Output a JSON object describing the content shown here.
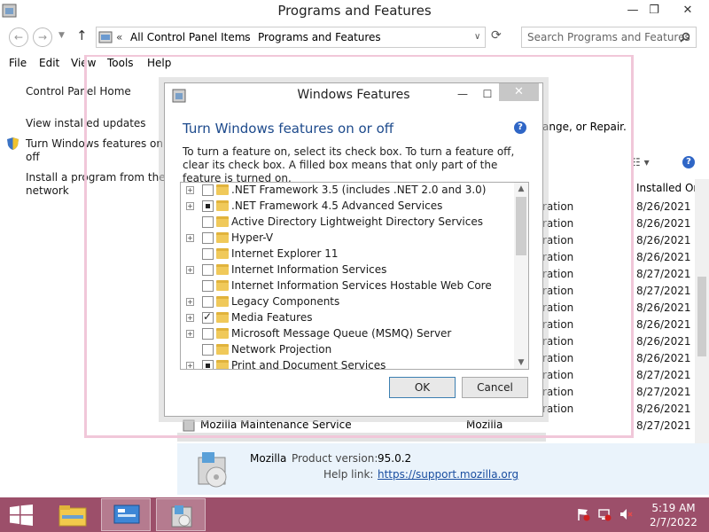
{
  "window": {
    "title": "Programs and Features",
    "controls": {
      "minimize": "—",
      "maximize": "❐",
      "close": "✕"
    }
  },
  "address": {
    "prefix": "«",
    "crumbs": [
      "All Control Panel Items",
      "Programs and Features"
    ],
    "separator": "›",
    "search_placeholder": "Search Programs and Features"
  },
  "menu": [
    "File",
    "Edit",
    "View",
    "Tools",
    "Help"
  ],
  "left_pane": {
    "home": "Control Panel Home",
    "view_updates": "View installed updates",
    "turn_features_line1": "Turn Windows features on or",
    "turn_features_line2": "off",
    "install_line1": "Install a program from the",
    "install_line2": "network"
  },
  "background": {
    "right_text": "ange, or Repair.",
    "installed_on_header": "Installed On",
    "publisher_fragments": [
      "ration",
      "ration",
      "ration",
      "ration",
      "ration",
      "ration",
      "ration",
      "ration",
      "ration",
      "ration",
      "ration",
      "ration",
      "ration"
    ],
    "installed_dates": [
      "8/26/2021",
      "8/26/2021",
      "8/26/2021",
      "8/26/2021",
      "8/27/2021",
      "8/27/2021",
      "8/26/2021",
      "8/26/2021",
      "8/26/2021",
      "8/26/2021",
      "8/27/2021",
      "8/27/2021",
      "8/26/2021",
      "8/27/2021"
    ],
    "bottom_row": {
      "name": "Mozilla Maintenance Service",
      "publisher": "Mozilla"
    }
  },
  "details": {
    "name": "Mozilla",
    "product_version_label": "Product version:",
    "product_version": "95.0.2",
    "help_link_label": "Help link:",
    "help_link": "https://support.mozilla.org"
  },
  "dialog": {
    "title": "Windows Features",
    "heading": "Turn Windows features on or off",
    "help_glyph": "?",
    "instructions": "To turn a feature on, select its check box. To turn a feature off, clear its check box. A filled box means that only part of the feature is turned on.",
    "features": [
      {
        "name": ".NET Framework 3.5 (includes .NET 2.0 and 3.0)",
        "expandable": true,
        "state": "unchecked"
      },
      {
        "name": ".NET Framework 4.5 Advanced Services",
        "expandable": true,
        "state": "partial"
      },
      {
        "name": "Active Directory Lightweight Directory Services",
        "expandable": false,
        "state": "unchecked"
      },
      {
        "name": "Hyper-V",
        "expandable": true,
        "state": "unchecked"
      },
      {
        "name": "Internet Explorer 11",
        "expandable": false,
        "state": "unchecked"
      },
      {
        "name": "Internet Information Services",
        "expandable": true,
        "state": "unchecked"
      },
      {
        "name": "Internet Information Services Hostable Web Core",
        "expandable": false,
        "state": "unchecked"
      },
      {
        "name": "Legacy Components",
        "expandable": true,
        "state": "unchecked"
      },
      {
        "name": "Media Features",
        "expandable": true,
        "state": "checked"
      },
      {
        "name": "Microsoft Message Queue (MSMQ) Server",
        "expandable": true,
        "state": "unchecked"
      },
      {
        "name": "Network Projection",
        "expandable": false,
        "state": "unchecked"
      },
      {
        "name": "Print and Document Services",
        "expandable": true,
        "state": "partial"
      }
    ],
    "ok_label": "OK",
    "cancel_label": "Cancel"
  },
  "taskbar": {
    "time": "5:19 AM",
    "date": "2/7/2022",
    "accent_color": "#9c4f6a"
  }
}
